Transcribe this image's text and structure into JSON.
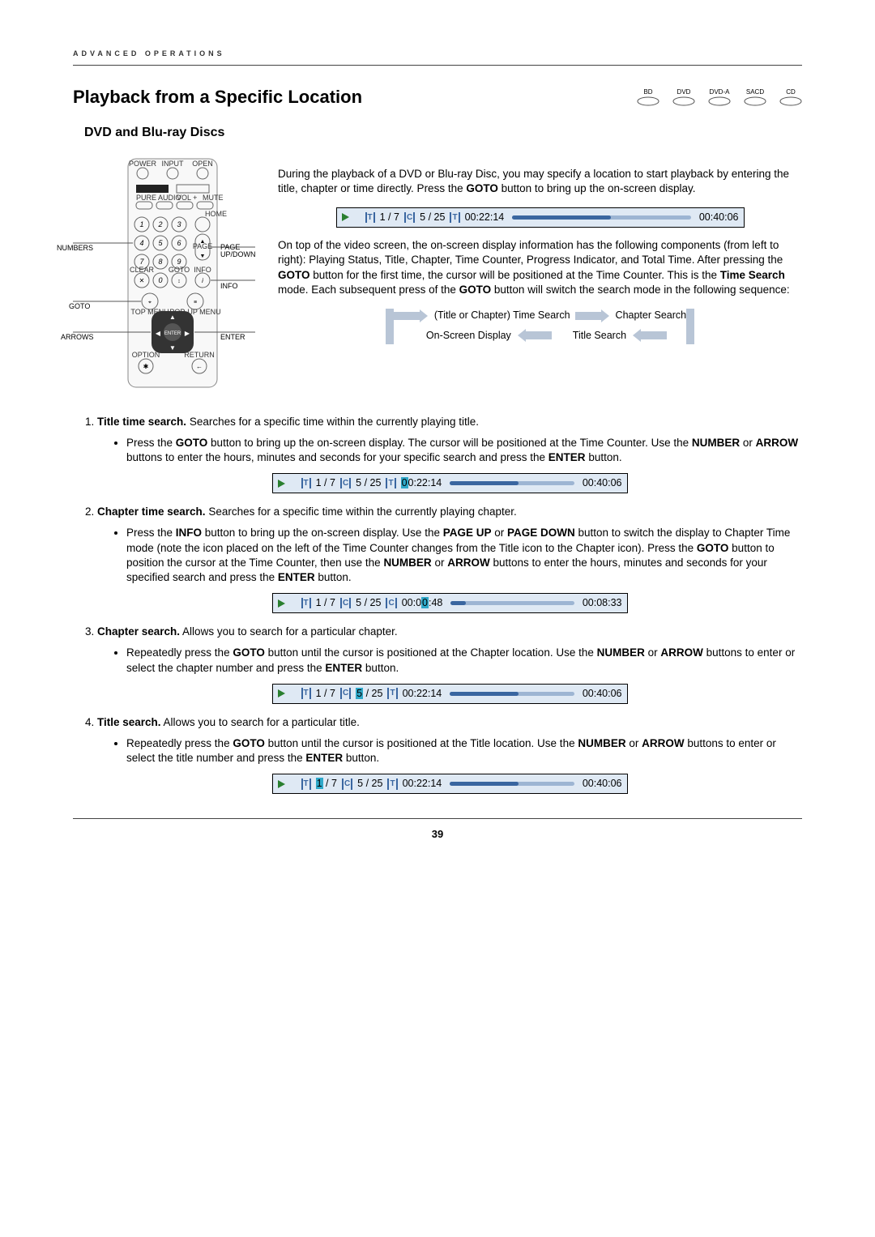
{
  "header": "ADVANCED OPERATIONS",
  "section_title": "Playback from a Specific Location",
  "disc_types": [
    "BD",
    "DVD",
    "DVD-A",
    "SACD",
    "CD"
  ],
  "subheading": "DVD and Blu-ray Discs",
  "remote_labels": {
    "numbers": "NUMBERS",
    "goto": "GOTO",
    "arrows": "ARROWS",
    "page": "PAGE UP/DOWN",
    "info": "INFO",
    "enter": "ENTER"
  },
  "intro_p1": "During the playback of a DVD or Blu-ray Disc, you may specify a location to start playback by entering the title, chapter or time directly. Press the ",
  "intro_goto": "GOTO",
  "intro_p1_tail": " button to bring up the on-screen display.",
  "osd": {
    "title_frac": "1 / 7",
    "chap_frac": "5 / 25",
    "time1": "00:22:14",
    "total1": "00:40:06",
    "time2_pre": "0",
    "time2_mid": "0:22:14",
    "total2": "00:40:06",
    "time3_a": "00:0",
    "time3_b": "0",
    "time3_c": ":48",
    "total3": "00:08:33",
    "chap4_a": "5",
    "chap4_b": " / 25",
    "total4": "00:40:06",
    "title5_a": "1",
    "title5_b": " / 7",
    "total5": "00:40:06"
  },
  "intro_p2a": "On top of the video screen, the on-screen display information has the following components (from left to right): Playing Status, Title, Chapter, Time Counter, Progress Indicator, and Total Time. After pressing the ",
  "intro_p2b": " button for the first time, the cursor will be positioned at the Time Counter. This is the ",
  "time_search": "Time Search",
  "intro_p2c": " mode. Each subsequent press of the ",
  "intro_p2d": " button will switch the search mode in the following sequence:",
  "seq": {
    "a": "(Title or Chapter) Time Search",
    "b": "Chapter Search",
    "c": "On-Screen Display",
    "d": "Title Search"
  },
  "items": {
    "1": {
      "title": "Title time search.",
      "desc": " Searches for a specific time within the currently playing title.",
      "bullet": "Press the GOTO button to bring up the on-screen display. The cursor will be positioned at the Time Counter. Use the NUMBER or ARROW buttons to enter the hours, minutes and seconds for your specific search and press the ENTER button."
    },
    "2": {
      "title": "Chapter time search.",
      "desc": " Searches for a specific time within the currently playing chapter.",
      "bullet": "Press the INFO button to bring up the on-screen display. Use the PAGE UP or PAGE DOWN button to switch the display to Chapter Time mode (note the icon placed on the left of the Time Counter changes from the Title icon to the Chapter icon). Press the GOTO button to position the cursor at the Time Counter, then use the NUMBER or ARROW buttons to enter the hours, minutes and seconds for your specified search and press the ENTER button."
    },
    "3": {
      "title": "Chapter search.",
      "desc": " Allows you to search for a particular chapter.",
      "bullet": "Repeatedly press the GOTO button until the cursor is positioned at the Chapter location.  Use the NUMBER or ARROW buttons to enter or select the chapter number and press the ENTER button."
    },
    "4": {
      "title": "Title search.",
      "desc": " Allows you to search for a particular title.",
      "bullet": "Repeatedly press the GOTO button until the cursor is positioned at the Title location.  Use the NUMBER or ARROW buttons to enter or select the title number and press the ENTER button."
    }
  },
  "page_number": "39"
}
